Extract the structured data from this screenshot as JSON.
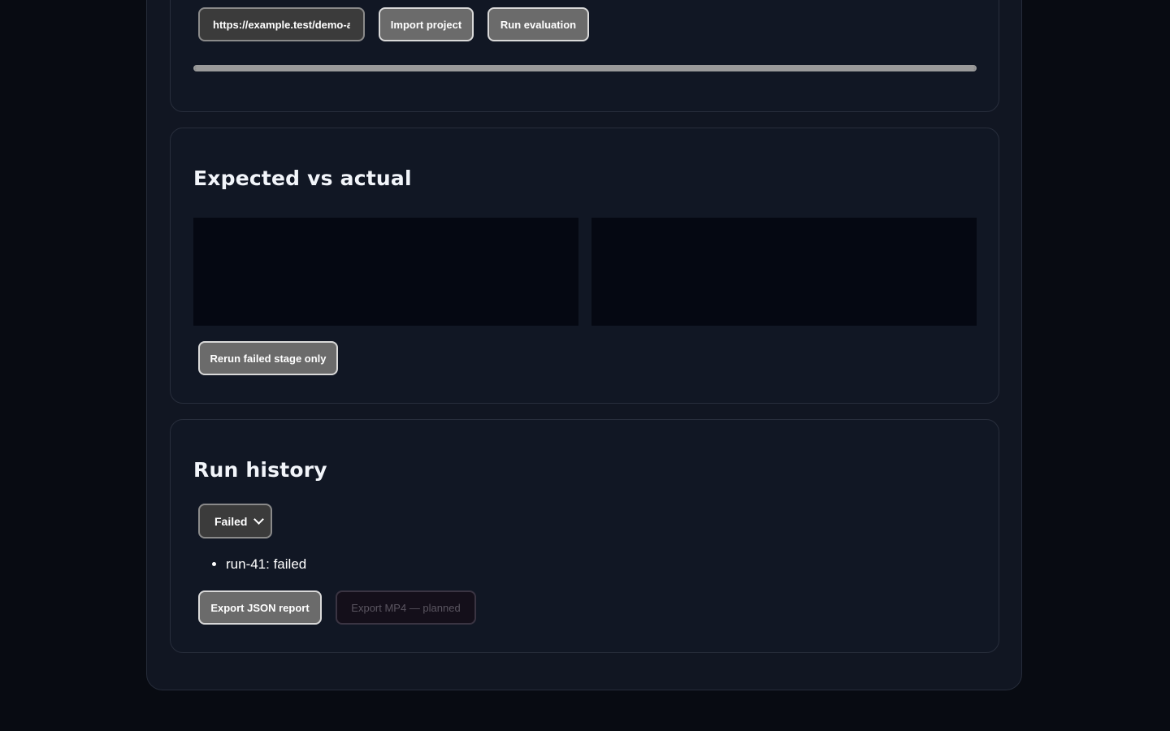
{
  "import": {
    "url_value": "https://example.test/demo-ag",
    "import_label": "Import project",
    "run_label": "Run evaluation",
    "progress": 1.0
  },
  "compare": {
    "title": "Expected vs actual",
    "rerun_label": "Rerun failed stage only"
  },
  "history": {
    "title": "Run history",
    "filter_selected": "Failed",
    "runs": [
      "run-41: failed"
    ],
    "export_json_label": "Export JSON report",
    "export_mp4_label": "Export MP4 — planned"
  },
  "colors": {
    "page_bg": "#080b12",
    "card_bg": "#111724",
    "button_bg": "#6b6b6b",
    "panel_bg": "#050812"
  }
}
